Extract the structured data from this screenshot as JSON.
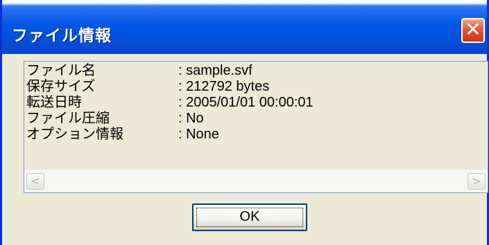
{
  "window": {
    "title": "ファイル情報",
    "close_symbol": "✕"
  },
  "file_info": {
    "rows": [
      {
        "label": "ファイル名",
        "value": ": sample.svf"
      },
      {
        "label": "保存サイズ",
        "value": ": 212792 bytes"
      },
      {
        "label": "転送日時",
        "value": ": 2005/01/01 00:00:01"
      },
      {
        "label": "ファイル圧縮",
        "value": ": No"
      },
      {
        "label": "オプション情報",
        "value": ": None"
      }
    ]
  },
  "scrollbar": {
    "left_arrow": "<",
    "right_arrow": ">"
  },
  "buttons": {
    "ok_label": "OK"
  },
  "colors": {
    "titlebar": "#0055e5",
    "close_button": "#e35d3a",
    "dialog_face": "#ece9d8",
    "ok_border": "#003c74"
  },
  "icons": {
    "close": "close-icon",
    "scroll_left": "scroll-left-arrow-icon",
    "scroll_right": "scroll-right-arrow-icon"
  }
}
